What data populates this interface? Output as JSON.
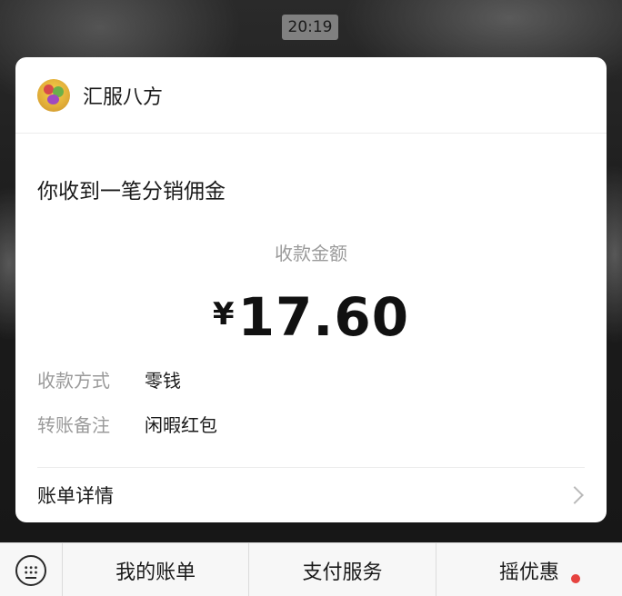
{
  "status": {
    "time": "20:19"
  },
  "card": {
    "merchant": {
      "name": "汇服八方",
      "avatar_icon": "merchant-avatar"
    },
    "title": "你收到一笔分销佣金",
    "amount_label": "收款金额",
    "amount": {
      "currency": "¥",
      "value": "17.60"
    },
    "details": [
      {
        "key": "收款方式",
        "value": "零钱"
      },
      {
        "key": "转账备注",
        "value": "闲暇红包"
      }
    ],
    "bill_detail_label": "账单详情"
  },
  "bottom_menu": {
    "keyboard_icon": "keyboard-icon",
    "items": [
      {
        "label": "我的账单"
      },
      {
        "label": "支付服务"
      },
      {
        "label": "摇优惠"
      }
    ],
    "badge_color": "#e64340"
  }
}
